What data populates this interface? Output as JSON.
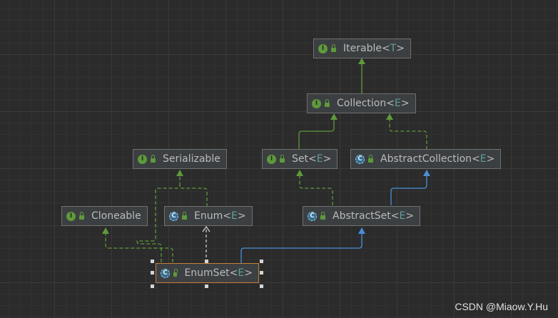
{
  "diagram": {
    "nodes": [
      {
        "id": "iterable",
        "kind": "interface",
        "badge": "I",
        "name": "Iterable",
        "type_param": "T"
      },
      {
        "id": "collection",
        "kind": "interface",
        "badge": "I",
        "name": "Collection",
        "type_param": "E"
      },
      {
        "id": "serializable",
        "kind": "interface",
        "badge": "I",
        "name": "Serializable",
        "type_param": ""
      },
      {
        "id": "set",
        "kind": "interface",
        "badge": "I",
        "name": "Set",
        "type_param": "E"
      },
      {
        "id": "abstractcollection",
        "kind": "abstract-class",
        "badge": "C",
        "name": "AbstractCollection",
        "type_param": "E"
      },
      {
        "id": "cloneable",
        "kind": "interface",
        "badge": "I",
        "name": "Cloneable",
        "type_param": ""
      },
      {
        "id": "enum",
        "kind": "abstract-class",
        "badge": "C",
        "name": "Enum",
        "type_param": "E"
      },
      {
        "id": "abstractset",
        "kind": "abstract-class",
        "badge": "C",
        "name": "AbstractSet",
        "type_param": "E"
      },
      {
        "id": "enumset",
        "kind": "abstract-class",
        "badge": "C",
        "name": "EnumSet",
        "type_param": "E",
        "selected": true
      }
    ],
    "edges": [
      {
        "from": "collection",
        "to": "iterable",
        "relation": "extends"
      },
      {
        "from": "set",
        "to": "collection",
        "relation": "extends"
      },
      {
        "from": "abstractcollection",
        "to": "collection",
        "relation": "implements"
      },
      {
        "from": "abstractset",
        "to": "set",
        "relation": "implements"
      },
      {
        "from": "abstractset",
        "to": "abstractcollection",
        "relation": "extends"
      },
      {
        "from": "enum",
        "to": "serializable",
        "relation": "implements"
      },
      {
        "from": "enumset",
        "to": "serializable",
        "relation": "implements"
      },
      {
        "from": "enumset",
        "to": "cloneable",
        "relation": "implements"
      },
      {
        "from": "enumset",
        "to": "enum",
        "relation": "dependency"
      },
      {
        "from": "enumset",
        "to": "abstractset",
        "relation": "extends"
      }
    ]
  },
  "colors": {
    "implements": "#5e9a3c",
    "extends_class": "#4a8fd8",
    "dependency": "#cfcfcf",
    "selection": "#c77f3a"
  },
  "watermark": "CSDN @Miaow.Y.Hu"
}
